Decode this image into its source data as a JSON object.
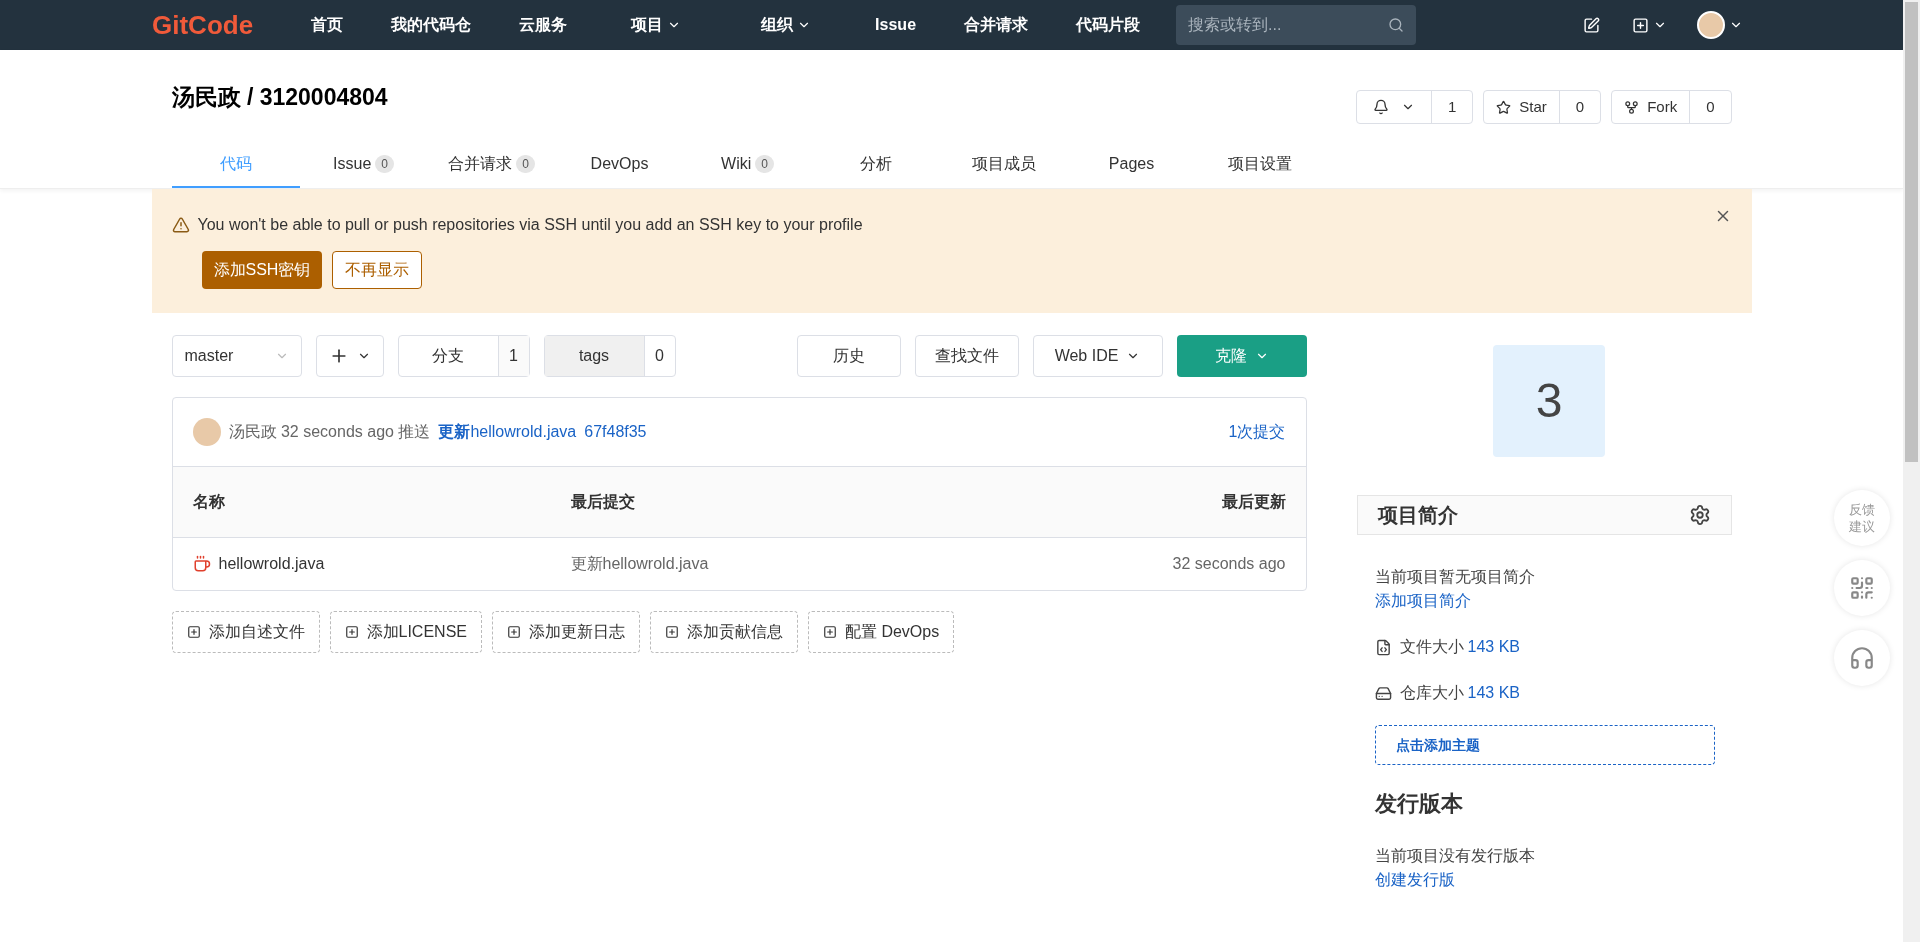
{
  "nav": {
    "logo": "GitCode",
    "items": [
      {
        "label": "首页",
        "kind": "link"
      },
      {
        "label": "我的代码仓",
        "kind": "link"
      },
      {
        "label": "云服务",
        "kind": "link"
      },
      {
        "label": "项目",
        "kind": "dropdown"
      },
      {
        "label": "组织",
        "kind": "dropdown"
      },
      {
        "label": "Issue",
        "kind": "link"
      },
      {
        "label": "合并请求",
        "kind": "link"
      },
      {
        "label": "代码片段",
        "kind": "link"
      }
    ],
    "search": {
      "placeholder": "搜索或转到..."
    }
  },
  "project": {
    "title": "汤民政 / 3120004804",
    "watch_count": "1",
    "star": {
      "label": "Star",
      "count": "0"
    },
    "fork": {
      "label": "Fork",
      "count": "0"
    }
  },
  "tabs": [
    {
      "label": "代码",
      "selected": true
    },
    {
      "label": "Issue",
      "count": "0",
      "selected": false
    },
    {
      "label": "合并请求",
      "count": "0",
      "selected": false
    },
    {
      "label": "DevOps",
      "selected": false
    },
    {
      "label": "Wiki",
      "count": "0",
      "selected": false
    },
    {
      "label": "分析",
      "selected": false
    },
    {
      "label": "项目成员",
      "selected": false
    },
    {
      "label": "Pages",
      "selected": false
    },
    {
      "label": "项目设置",
      "selected": false
    }
  ],
  "alert": {
    "message": "You won't be able to pull or push repositories via SSH until you add an SSH key to your profile",
    "primary_button": "添加SSH密钥",
    "secondary_button": "不再显示"
  },
  "toolbar": {
    "branch": "master",
    "branches": {
      "label": "分支",
      "count": "1"
    },
    "tags": {
      "label": "tags",
      "count": "0"
    },
    "history": "历史",
    "find_file": "查找文件",
    "web_ide": "Web IDE",
    "clone": "克隆"
  },
  "last_commit": {
    "author": "汤民政",
    "time": "32 seconds ago",
    "action": "推送",
    "message": "**更新**hellowrold.java",
    "sha": "67f48f35",
    "commit_count": "1次提交"
  },
  "table": {
    "columns": [
      "名称",
      "最后提交",
      "最后更新"
    ],
    "rows": [
      {
        "name": "hellowrold.java",
        "commit": "更新hellowrold.java",
        "updated": "32 seconds ago"
      }
    ]
  },
  "add_buttons": [
    "添加自述文件",
    "添加LICENSE",
    "添加更新日志",
    "添加贡献信息",
    "配置 DevOps"
  ],
  "sidebar": {
    "project_avatar": "3",
    "about_title": "项目简介",
    "no_description": "当前项目暂无项目简介",
    "add_description": "添加项目简介",
    "file_size": {
      "label": "文件大小",
      "value": "143 KB"
    },
    "repo_size": {
      "label": "仓库大小",
      "value": "143 KB"
    },
    "add_topic": "点击添加主题",
    "releases_title": "发行版本",
    "no_releases": "当前项目没有发行版本",
    "create_release": "创建发行版"
  },
  "floating": {
    "feedback": "反馈建议"
  }
}
